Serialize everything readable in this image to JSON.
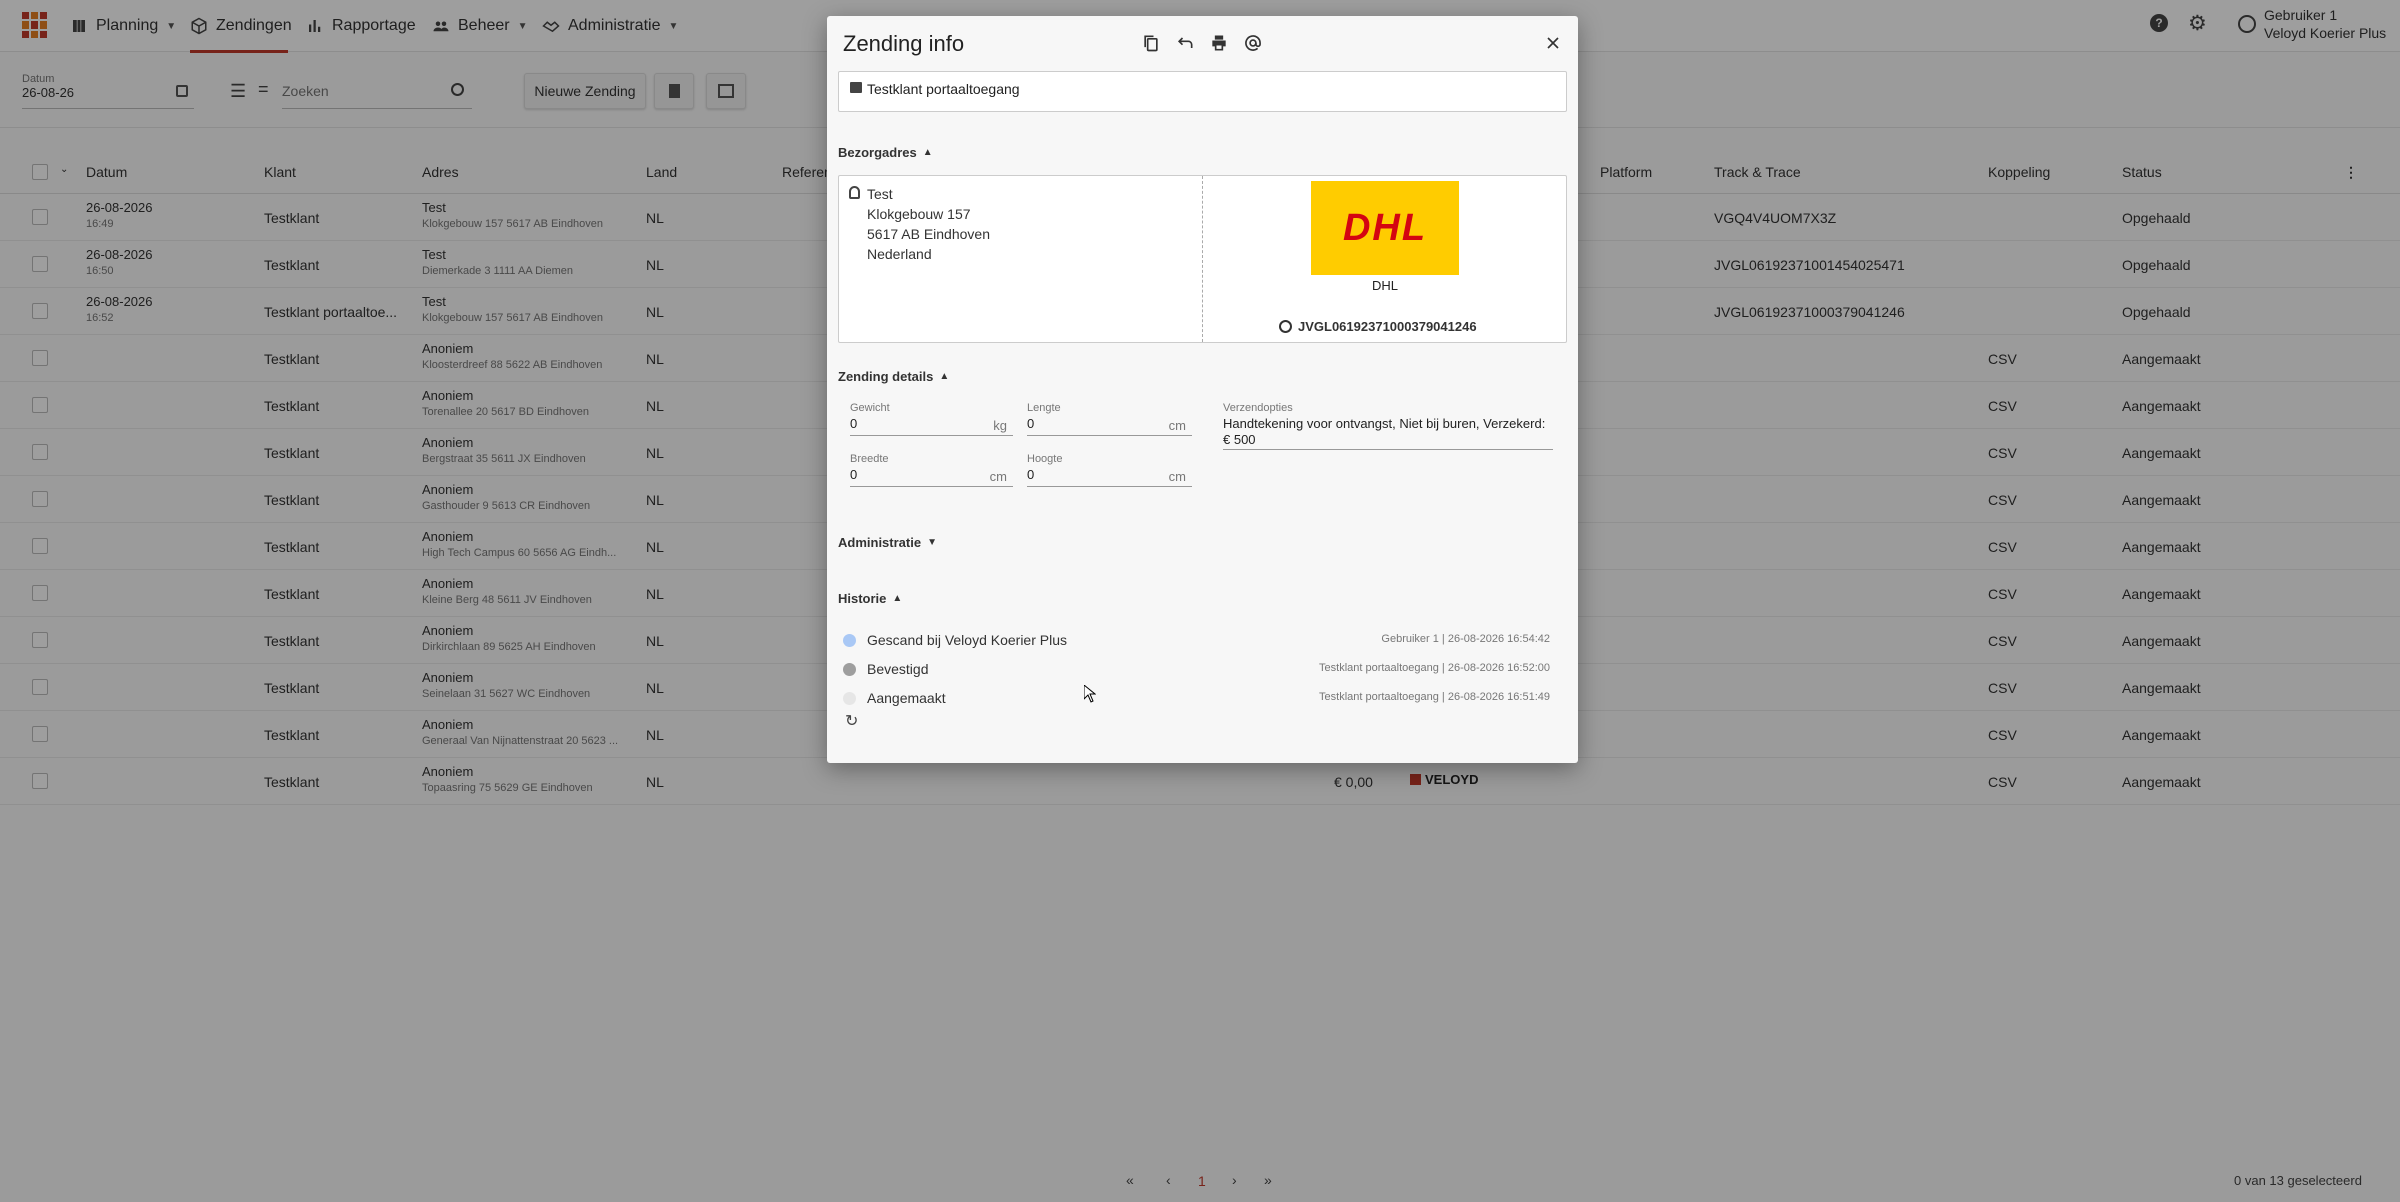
{
  "nav": {
    "items": [
      {
        "label": "Planning",
        "icon": "map-icon"
      },
      {
        "label": "Zendingen",
        "icon": "box-icon"
      },
      {
        "label": "Rapportage",
        "icon": "bar-chart-icon"
      },
      {
        "label": "Beheer",
        "icon": "users-icon"
      },
      {
        "label": "Administratie",
        "icon": "handshake-icon"
      }
    ],
    "user": {
      "name": "Gebruiker 1",
      "company": "Veloyd Koerier Plus"
    }
  },
  "toolbar": {
    "date_label": "Datum",
    "date_value": "26-08-26",
    "search_placeholder": "Zoeken",
    "new_button": "Nieuwe Zending"
  },
  "table": {
    "columns": [
      "Datum",
      "Klant",
      "Adres",
      "Land",
      "Referen",
      "Platform",
      "Track & Trace",
      "Koppeling",
      "Status"
    ],
    "rows": [
      {
        "date": "26-08-2026",
        "time": "16:49",
        "klant": "Testklant",
        "addr_name": "Test",
        "addr_line": "Klokgebouw 157 5617 AB Eindhoven",
        "land": "NL",
        "track": "VGQ4V4UOM7X3Z",
        "koppeling": "",
        "status": "Opgehaald"
      },
      {
        "date": "26-08-2026",
        "time": "16:50",
        "klant": "Testklant",
        "addr_name": "Test",
        "addr_line": "Diemerkade 3 1111 AA Diemen",
        "land": "NL",
        "track": "JVGL06192371001454025471",
        "koppeling": "",
        "status": "Opgehaald"
      },
      {
        "date": "26-08-2026",
        "time": "16:52",
        "klant": "Testklant portaaltoe...",
        "addr_name": "Test",
        "addr_line": "Klokgebouw 157 5617 AB Eindhoven",
        "land": "NL",
        "track": "JVGL06192371000379041246",
        "koppeling": "",
        "status": "Opgehaald"
      },
      {
        "date": "",
        "time": "",
        "klant": "Testklant",
        "addr_name": "Anoniem",
        "addr_line": "Kloosterdreef 88 5622 AB Eindhoven",
        "land": "NL",
        "track": "",
        "koppeling": "CSV",
        "status": "Aangemaakt"
      },
      {
        "date": "",
        "time": "",
        "klant": "Testklant",
        "addr_name": "Anoniem",
        "addr_line": "Torenallee 20 5617 BD Eindhoven",
        "land": "NL",
        "track": "",
        "koppeling": "CSV",
        "status": "Aangemaakt"
      },
      {
        "date": "",
        "time": "",
        "klant": "Testklant",
        "addr_name": "Anoniem",
        "addr_line": "Bergstraat 35 5611 JX Eindhoven",
        "land": "NL",
        "track": "",
        "koppeling": "CSV",
        "status": "Aangemaakt"
      },
      {
        "date": "",
        "time": "",
        "klant": "Testklant",
        "addr_name": "Anoniem",
        "addr_line": "Gasthouder 9 5613 CR Eindhoven",
        "land": "NL",
        "track": "",
        "koppeling": "CSV",
        "status": "Aangemaakt"
      },
      {
        "date": "",
        "time": "",
        "klant": "Testklant",
        "addr_name": "Anoniem",
        "addr_line": "High Tech Campus 60 5656 AG Eindh...",
        "land": "NL",
        "track": "",
        "koppeling": "CSV",
        "status": "Aangemaakt"
      },
      {
        "date": "",
        "time": "",
        "klant": "Testklant",
        "addr_name": "Anoniem",
        "addr_line": "Kleine Berg 48 5611 JV Eindhoven",
        "land": "NL",
        "track": "",
        "koppeling": "CSV",
        "status": "Aangemaakt"
      },
      {
        "date": "",
        "time": "",
        "klant": "Testklant",
        "addr_name": "Anoniem",
        "addr_line": "Dirkirchlaan 89 5625 AH Eindhoven",
        "land": "NL",
        "track": "",
        "koppeling": "CSV",
        "status": "Aangemaakt"
      },
      {
        "date": "",
        "time": "",
        "klant": "Testklant",
        "addr_name": "Anoniem",
        "addr_line": "Seinelaan 31 5627 WC Eindhoven",
        "land": "NL",
        "track": "",
        "koppeling": "CSV",
        "status": "Aangemaakt"
      },
      {
        "date": "",
        "time": "",
        "klant": "Testklant",
        "addr_name": "Anoniem",
        "addr_line": "Generaal Van Nijnattenstraat 20 5623 ...",
        "land": "NL",
        "track": "",
        "koppeling": "CSV",
        "status": "Aangemaakt"
      },
      {
        "date": "",
        "time": "",
        "klant": "Testklant",
        "addr_name": "Anoniem",
        "addr_line": "Topaasring 75 5629 GE Eindhoven",
        "land": "NL",
        "track": "",
        "koppeling": "CSV",
        "status": "Aangemaakt",
        "price": "€ 0,00",
        "carrier": "VELOYD"
      }
    ]
  },
  "footer": {
    "page": "1",
    "selection": "0 van 13 geselecteerd"
  },
  "modal": {
    "title": "Zending info",
    "client": "Testklant portaaltoegang",
    "address_section": "Bezorgadres",
    "address": {
      "name": "Test",
      "street": "Klokgebouw 157",
      "city": "5617 AB Eindhoven",
      "country": "Nederland"
    },
    "carrier_logo": "DHL",
    "carrier_name": "DHL",
    "tracking": "JVGL06192371000379041246",
    "details_section": "Zending details",
    "fields": {
      "gewicht": {
        "label": "Gewicht",
        "value": "0",
        "unit": "kg"
      },
      "lengte": {
        "label": "Lengte",
        "value": "0",
        "unit": "cm"
      },
      "breedte": {
        "label": "Breedte",
        "value": "0",
        "unit": "cm"
      },
      "hoogte": {
        "label": "Hoogte",
        "value": "0",
        "unit": "cm"
      },
      "opties": {
        "label": "Verzendopties",
        "value": "Handtekening voor ontvangst, Niet bij buren, Verzekerd: € 500"
      }
    },
    "admin_section": "Administratie",
    "history_section": "Historie",
    "history": [
      {
        "text": "Gescand bij Veloyd Koerier Plus",
        "meta": "Gebruiker 1 | 26-08-2026 16:54:42",
        "color": "#a9c8f5"
      },
      {
        "text": "Bevestigd",
        "meta": "Testklant portaaltoegang | 26-08-2026 16:52:00",
        "color": "#9e9e9e"
      },
      {
        "text": "Aangemaakt",
        "meta": "Testklant portaaltoegang | 26-08-2026 16:51:49",
        "color": "#e6e6e6"
      }
    ]
  }
}
